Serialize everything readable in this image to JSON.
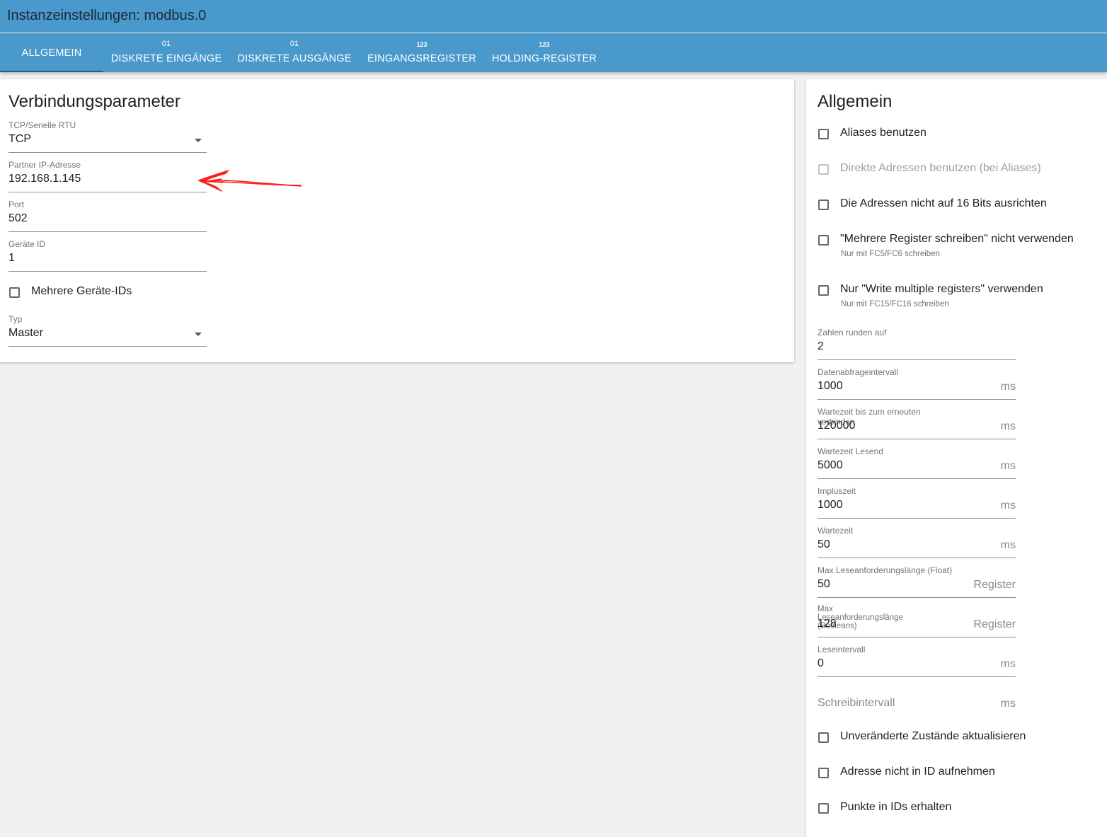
{
  "window": {
    "title": "Instanzeinstellungen: modbus.0"
  },
  "tabs": [
    {
      "sub": "",
      "label": "ALLGEMEIN",
      "active": true
    },
    {
      "sub": "01",
      "label": "DISKRETE EINGÄNGE"
    },
    {
      "sub": "01",
      "label": "DISKRETE AUSGÄNGE"
    },
    {
      "sub": "123",
      "label": "EINGANGSREGISTER"
    },
    {
      "sub": "123",
      "label": "HOLDING-REGISTER"
    }
  ],
  "connection": {
    "heading": "Verbindungsparameter",
    "mode": {
      "label": "TCP/Serielle RTU",
      "value": "TCP"
    },
    "ip": {
      "label": "Partner IP-Adresse",
      "value": "192.168.1.145"
    },
    "port": {
      "label": "Port",
      "value": "502"
    },
    "device_id": {
      "label": "Geräte ID",
      "value": "1"
    },
    "multi_ids": {
      "label": "Mehrere Geräte-IDs",
      "checked": false
    },
    "type": {
      "label": "Typ",
      "value": "Master"
    }
  },
  "general": {
    "heading": "Allgemein",
    "checkboxes": [
      {
        "label": "Aliases benutzen",
        "checked": false
      },
      {
        "label": "Direkte Adressen benutzen (bei Aliases)",
        "checked": false,
        "disabled": true
      },
      {
        "label": "Die Adressen nicht auf 16 Bits ausrichten",
        "checked": false
      },
      {
        "label": "\"Mehrere Register schreiben\" nicht verwenden",
        "help": "Nur mit FC5/FC6 schreiben",
        "checked": false
      },
      {
        "label": "Nur \"Write multiple registers\" verwenden",
        "help": "Nur mit FC15/FC16 schreiben",
        "checked": false
      }
    ],
    "fields": [
      {
        "label": "Zahlen runden auf",
        "value": "2",
        "unit": ""
      },
      {
        "label": "Datenabfrageintervall",
        "value": "1000",
        "unit": "ms"
      },
      {
        "label": "Wartezeit bis zum erneuten verbinden",
        "value": "120000",
        "unit": "ms"
      },
      {
        "label": "Wartezeit Lesend",
        "value": "5000",
        "unit": "ms"
      },
      {
        "label": "Impluszeit",
        "value": "1000",
        "unit": "ms"
      },
      {
        "label": "Wartezeit",
        "value": "50",
        "unit": "ms"
      },
      {
        "label": "Max Leseanforderungslänge (Float)",
        "value": "50",
        "unit": "Register"
      },
      {
        "label": "Max Leseanforderungslänge (Booleans)",
        "value": "128",
        "unit": "Register"
      },
      {
        "label": "Leseintervall",
        "value": "0",
        "unit": "ms"
      },
      {
        "label": "",
        "value": "",
        "placeholder": "Schreibintervall",
        "unit": "ms"
      }
    ],
    "bottom_checkboxes": [
      {
        "label": "Unveränderte Zustände aktualisieren",
        "checked": false
      },
      {
        "label": "Adresse nicht in ID aufnehmen",
        "checked": false
      },
      {
        "label": "Punkte in IDs erhalten",
        "checked": false
      }
    ]
  },
  "colors": {
    "header": "#4a99cc",
    "annotation_arrow": "#ff1a1a"
  }
}
